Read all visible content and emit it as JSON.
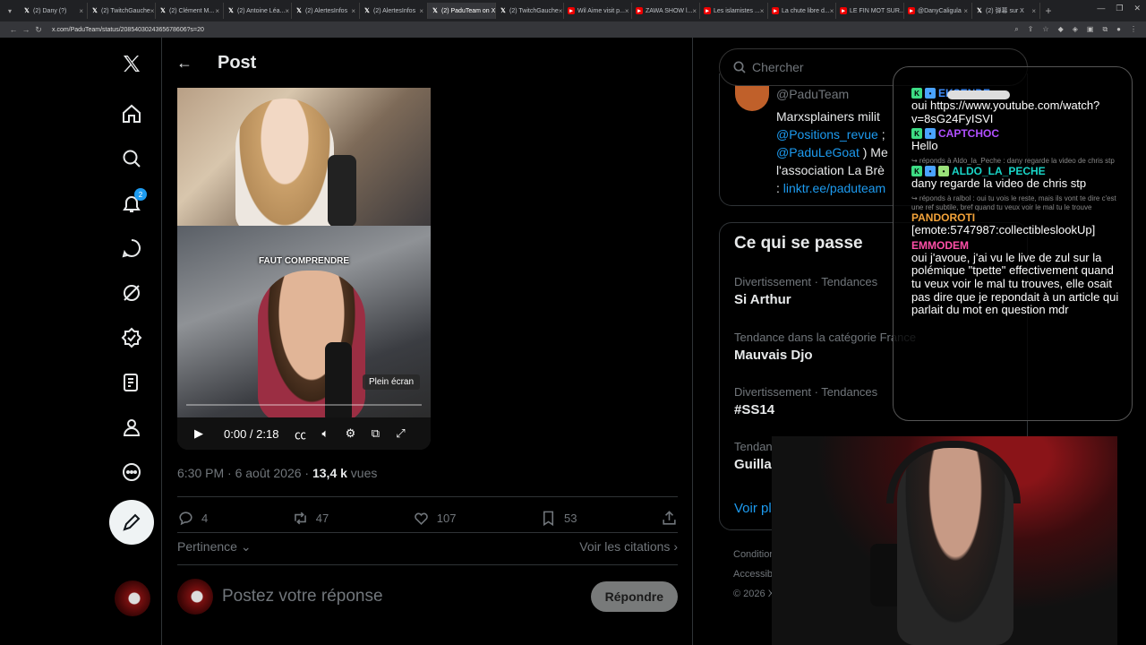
{
  "browser": {
    "tabs": [
      {
        "label": "(2) Dany (?)",
        "icon": "x-icon"
      },
      {
        "label": "(2) TwitchGauche",
        "icon": "x-icon"
      },
      {
        "label": "(2) Clément M...",
        "icon": "x-icon"
      },
      {
        "label": "(2) Antoine Léa...",
        "icon": "x-icon"
      },
      {
        "label": "(2) AlertesInfos",
        "icon": "x-icon"
      },
      {
        "label": "(2) AlertesInfos",
        "icon": "x-icon"
      },
      {
        "label": "(2) PaduTeam on X",
        "icon": "x-icon",
        "active": true
      },
      {
        "label": "(2) TwitchGauche",
        "icon": "x-icon"
      },
      {
        "label": "Wil Aime visit p...",
        "icon": "youtube-icon"
      },
      {
        "label": "ZAWA SHOW l...",
        "icon": "youtube-icon"
      },
      {
        "label": "Les islamistes ...",
        "icon": "youtube-icon"
      },
      {
        "label": "La chute libre d...",
        "icon": "youtube-icon"
      },
      {
        "label": "LE FIN MOT SUR...",
        "icon": "youtube-icon"
      },
      {
        "label": "@DanyCaligula",
        "icon": "youtube-icon"
      },
      {
        "label": "(2) 弹幕 sur X",
        "icon": "x-icon"
      }
    ],
    "url": "x.com/PaduTeam/status/2085403024365678606?s=20"
  },
  "nav": {
    "notification_count": "2"
  },
  "post": {
    "header_title": "Post",
    "video": {
      "caption": "FAUT COMPRENDRE",
      "tooltip": "Plein écran",
      "time": "0:00 / 2:18",
      "progress": 0
    },
    "meta_time": "6:30 PM · 6 août 2026 · ",
    "views_count": "13,4 k",
    "views_label": " vues",
    "replies": "4",
    "reposts": "47",
    "likes": "107",
    "bookmarks": "53",
    "sort_label": "Pertinence",
    "quotes_label": "Voir les citations",
    "reply_placeholder": "Postez votre réponse",
    "reply_button": "Répondre"
  },
  "right": {
    "search_placeholder": "Chercher",
    "profile": {
      "handle": "@PaduTeam",
      "bio_1": "Marxsplainers milit",
      "bio_link_1": "@Positions_revue",
      "bio_2": " ; ",
      "bio_link_2": "@PaduLeGoat",
      "bio_3": " ) Me",
      "bio_4": "l'association La Brè",
      "bio_5": ": ",
      "bio_link_3": "linktr.ee/paduteam"
    },
    "trends_title": "Ce qui se passe",
    "trends": [
      {
        "category": "Divertissement · Tendances",
        "name": "Si Arthur"
      },
      {
        "category": "Tendance dans la catégorie France",
        "name": "Mauvais Djo"
      },
      {
        "category": "Divertissement · Tendances",
        "name": "#SS14"
      },
      {
        "category": "Tendan",
        "name": "Guillau"
      }
    ],
    "show_more": "Voir pl",
    "footer_1": "Condition",
    "footer_2": "Accessib",
    "footer_3": "© 2026 X"
  },
  "chat": {
    "messages": [
      {
        "user": "EKSENDE",
        "color": "#3f8fff",
        "text": "oui https://www.youtube.com/watch?v=8sG24FyISVI",
        "reply": ""
      },
      {
        "user": "CAPTCHOC",
        "color": "#b04fff",
        "text": "Hello",
        "reply": ""
      },
      {
        "user": "ALDO_LA_PECHE",
        "color": "#19d6c8",
        "text": "dany regarde la video de chris stp",
        "reply": "↪ réponds à Aldo_la_Peche : dany regarde la video de chris stp"
      },
      {
        "user": "PANDOROTI",
        "color": "#f3a33a",
        "text": "[emote:5747987:collectibleslookUp]",
        "reply": "↪ réponds à ralbol : oui tu vois le reste, mais ils vont te dire c'est une ref subtile, bref quand tu veux voir le mal tu le trouve"
      },
      {
        "user": "EMMODEM",
        "color": "#ff4fa8",
        "text": "oui j'avoue, j'ai vu le live de zul sur la polémique \"tpette\" effectivement quand tu veux voir le mal tu trouves, elle osait pas dire que je repondait à un article qui parlait du mot en question mdr",
        "reply": ""
      }
    ]
  }
}
